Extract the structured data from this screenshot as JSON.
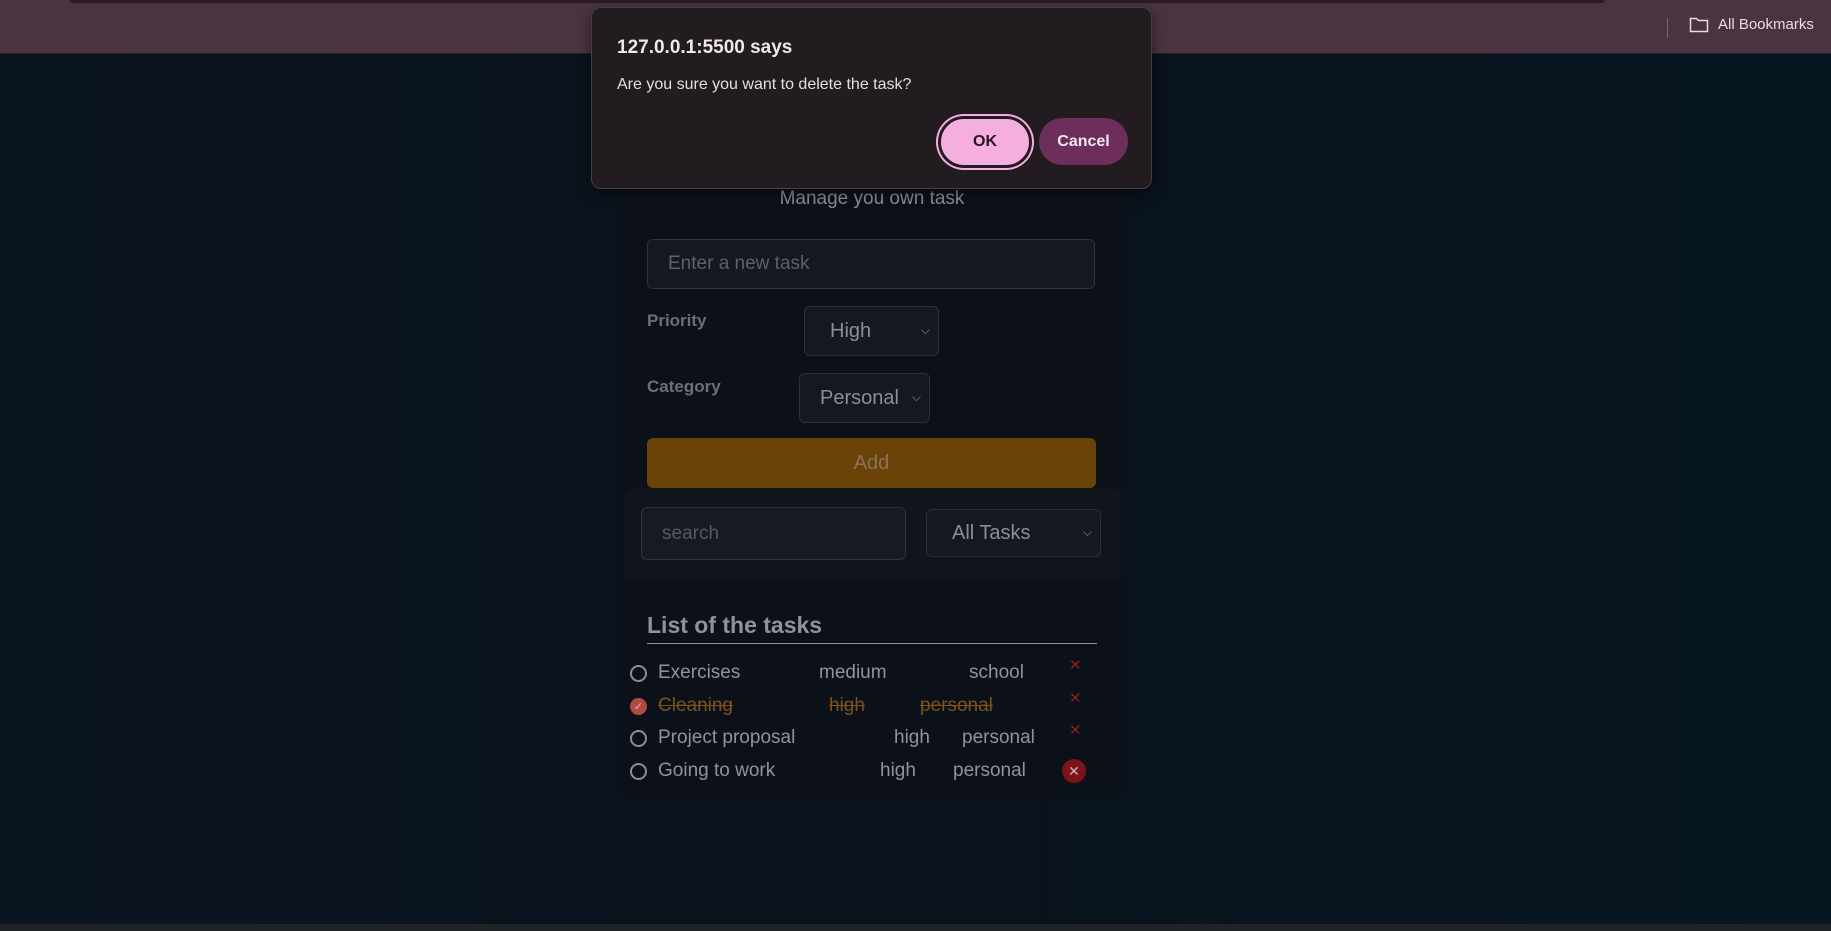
{
  "browser": {
    "bookmarks_label": "All Bookmarks"
  },
  "dialog": {
    "origin": "127.0.0.1:5500 says",
    "message": "Are you sure you want to delete the task?",
    "ok_label": "OK",
    "cancel_label": "Cancel"
  },
  "app": {
    "subtitle": "Manage you own task",
    "task_input_placeholder": "Enter a new task",
    "priority_label": "Priority",
    "priority_value": "High",
    "category_label": "Category",
    "category_value": "Personal",
    "add_label": "Add",
    "search_placeholder": "search",
    "filter_value": "All Tasks",
    "list_title": "List of the tasks",
    "tasks": [
      {
        "name": "Exercises",
        "priority": "medium",
        "category": "school",
        "completed": false
      },
      {
        "name": "Cleaning",
        "priority": "high",
        "category": "personal",
        "completed": true
      },
      {
        "name": "Project proposal",
        "priority": "high",
        "category": "personal",
        "completed": false
      },
      {
        "name": "Going to work",
        "priority": "high",
        "category": "personal",
        "completed": false
      }
    ]
  },
  "colors": {
    "accent": "#f5aee0",
    "cancel": "#6e2e5b",
    "add_button": "#6a4309",
    "delete": "#8f1d22"
  }
}
